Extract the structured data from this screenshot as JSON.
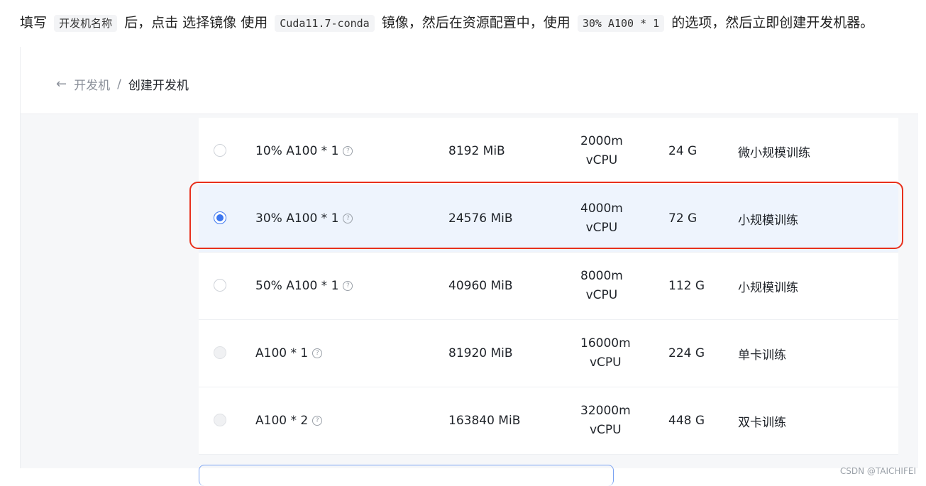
{
  "instruction": {
    "p1": "填写",
    "code1": "开发机名称",
    "p2": "后，点击 选择镜像 使用",
    "code2": "Cuda11.7-conda",
    "p3": "镜像，然后在资源配置中，使用",
    "code3": "30% A100 * 1",
    "p4": "的选项，然后立即创建开发机器。"
  },
  "breadcrumb": {
    "back_icon": "←",
    "parent": "开发机",
    "separator": "/",
    "current": "创建开发机"
  },
  "spec_rows": [
    {
      "spec": "10% A100 * 1",
      "memory": "8192 MiB",
      "cpu_line1": "2000m",
      "cpu_line2": "vCPU",
      "disk": "24 G",
      "usage": "微小规模训练",
      "state": "unchecked"
    },
    {
      "spec": "30% A100 * 1",
      "memory": "24576 MiB",
      "cpu_line1": "4000m",
      "cpu_line2": "vCPU",
      "disk": "72 G",
      "usage": "小规模训练",
      "state": "checked"
    },
    {
      "spec": "50% A100 * 1",
      "memory": "40960 MiB",
      "cpu_line1": "8000m",
      "cpu_line2": "vCPU",
      "disk": "112 G",
      "usage": "小规模训练",
      "state": "unchecked"
    },
    {
      "spec": "A100 * 1",
      "memory": "81920 MiB",
      "cpu_line1": "16000m",
      "cpu_line2": "vCPU",
      "disk": "224 G",
      "usage": "单卡训练",
      "state": "disabled"
    },
    {
      "spec": "A100 * 2",
      "memory": "163840 MiB",
      "cpu_line1": "32000m",
      "cpu_line2": "vCPU",
      "disk": "448 G",
      "usage": "双卡训练",
      "state": "disabled"
    }
  ],
  "help_icon_glyph": "?",
  "watermark": "CSDN @TAICHIFEI",
  "colors": {
    "accent": "#3c76f0",
    "selected_row_bg": "#eef4fd",
    "annotation_red": "#e8301c"
  }
}
